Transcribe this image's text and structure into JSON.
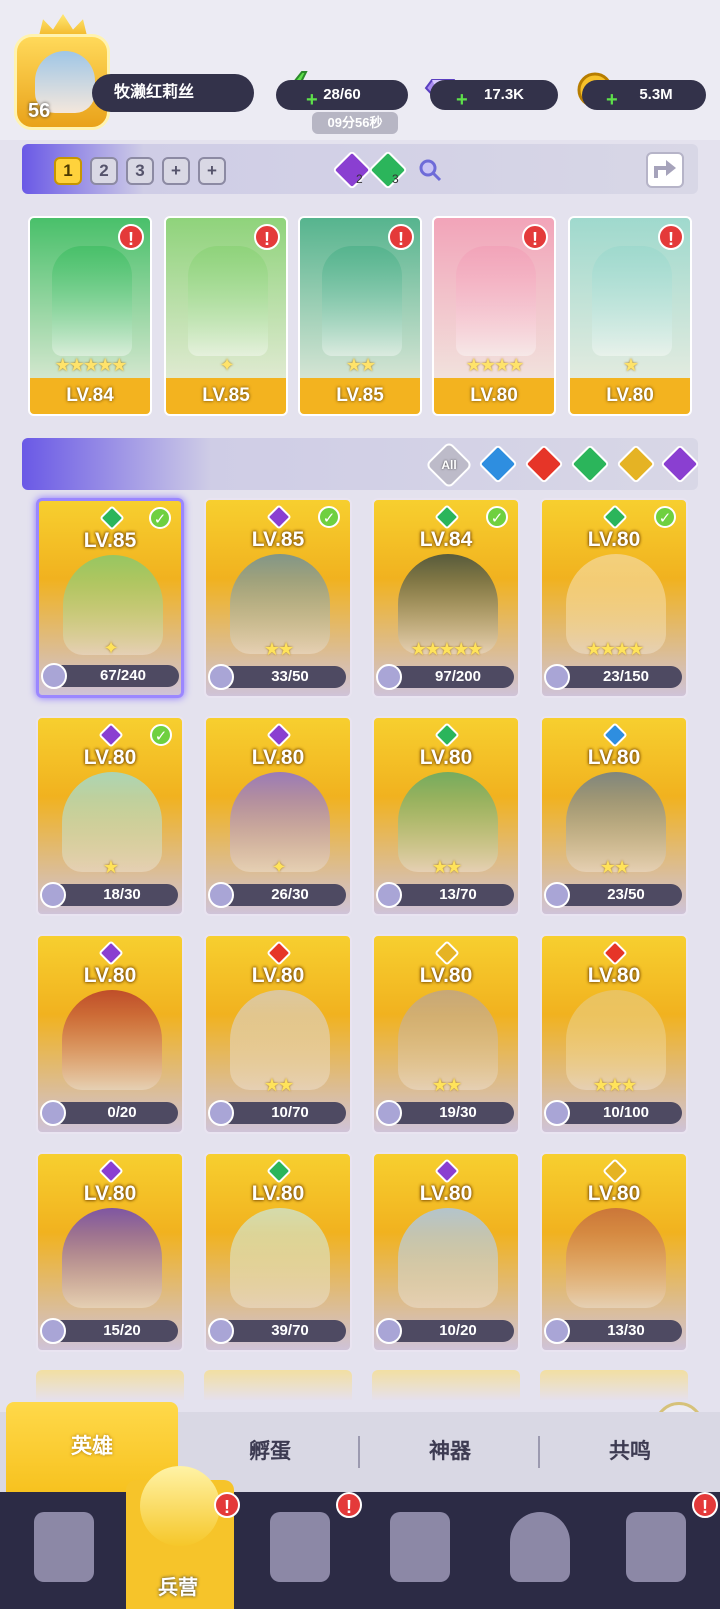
{
  "player": {
    "level": "56",
    "name": "牧濑红莉丝"
  },
  "resources": {
    "energy": "28/60",
    "energy_timer": "09分56秒",
    "gems": "17.3K",
    "gold": "5.3M"
  },
  "team_bar": {
    "slots": [
      "1",
      "2",
      "3",
      "+",
      "+"
    ],
    "gem_a_count": "2",
    "gem_b_count": "3"
  },
  "team": [
    {
      "level": "LV.84",
      "stars": "★★★★★",
      "element": "green",
      "color": "#49c06a",
      "alert": "!"
    },
    {
      "level": "LV.85",
      "stars": "✦",
      "element": "green",
      "color": "#8fd37b",
      "alert": "!"
    },
    {
      "level": "LV.85",
      "stars": "★★",
      "element": "purple",
      "color": "#56b48e",
      "alert": "!"
    },
    {
      "level": "LV.80",
      "stars": "★★★★",
      "element": "green",
      "color": "#f2a4b9",
      "alert": "!"
    },
    {
      "level": "LV.80",
      "stars": "★",
      "element": "purple",
      "color": "#9fd9cd",
      "alert": "!"
    }
  ],
  "filters": {
    "all_label": "All",
    "colors": {
      "water": "#2e8ee0",
      "fire": "#e63528",
      "wind": "#2bb55b",
      "light": "#e5b324",
      "dark": "#8a3fd1"
    }
  },
  "heroes": [
    {
      "level": "LV.85",
      "fragments": "67/240",
      "stars": "✦",
      "element_color": "#2bb55b",
      "check": "✓",
      "tint": "#86c86c"
    },
    {
      "level": "LV.85",
      "fragments": "33/50",
      "stars": "★★",
      "element_color": "#8a3fd1",
      "check": "✓",
      "tint": "#6e8f98"
    },
    {
      "level": "LV.84",
      "fragments": "97/200",
      "stars": "★★★★★",
      "element_color": "#2bb55b",
      "check": "✓",
      "tint": "#3c4a40"
    },
    {
      "level": "LV.80",
      "fragments": "23/150",
      "stars": "★★★★",
      "element_color": "#2bb55b",
      "check": "✓",
      "tint": "#f3d38c"
    },
    {
      "level": "LV.80",
      "fragments": "18/30",
      "stars": "★",
      "element_color": "#8a3fd1",
      "check": "✓",
      "tint": "#9fd9cd"
    },
    {
      "level": "LV.80",
      "fragments": "26/30",
      "stars": "✦",
      "element_color": "#8a3fd1",
      "check": "",
      "tint": "#8b6fd0"
    },
    {
      "level": "LV.80",
      "fragments": "13/70",
      "stars": "★★",
      "element_color": "#2bb55b",
      "check": "",
      "tint": "#5fa868"
    },
    {
      "level": "LV.80",
      "fragments": "23/50",
      "stars": "★★",
      "element_color": "#2e8ee0",
      "check": "",
      "tint": "#6b7c8c"
    },
    {
      "level": "LV.80",
      "fragments": "0/20",
      "stars": "",
      "element_color": "#8a3fd1",
      "check": "",
      "tint": "#b63a2a"
    },
    {
      "level": "LV.80",
      "fragments": "10/70",
      "stars": "★★",
      "element_color": "#e63528",
      "check": "",
      "tint": "#d8c9b3"
    },
    {
      "level": "LV.80",
      "fragments": "19/30",
      "stars": "★★",
      "element_color": "#e5b324",
      "check": "",
      "tint": "#bfa486"
    },
    {
      "level": "LV.80",
      "fragments": "10/100",
      "stars": "★★★",
      "element_color": "#e63528",
      "check": "",
      "tint": "#e8c46a"
    },
    {
      "level": "LV.80",
      "fragments": "15/20",
      "stars": "",
      "element_color": "#8a3fd1",
      "check": "",
      "tint": "#6a44b8"
    },
    {
      "level": "LV.80",
      "fragments": "39/70",
      "stars": "",
      "element_color": "#2bb55b",
      "check": "",
      "tint": "#cfe0c4"
    },
    {
      "level": "LV.80",
      "fragments": "10/20",
      "stars": "",
      "element_color": "#8a3fd1",
      "check": "",
      "tint": "#a8c6ea"
    },
    {
      "level": "LV.80",
      "fragments": "13/30",
      "stars": "",
      "element_color": "#e5b324",
      "check": "",
      "tint": "#c46a3c"
    }
  ],
  "sub_tabs": [
    "英雄",
    "孵蛋",
    "神器",
    "共鸣"
  ],
  "bottom_nav": {
    "active_label": "兵营",
    "icons": [
      "cards-icon",
      "barracks-icon",
      "book-icon",
      "castle-icon",
      "mushroom-icon",
      "banner-icon"
    ]
  },
  "alerts": {
    "symbol": "!"
  }
}
